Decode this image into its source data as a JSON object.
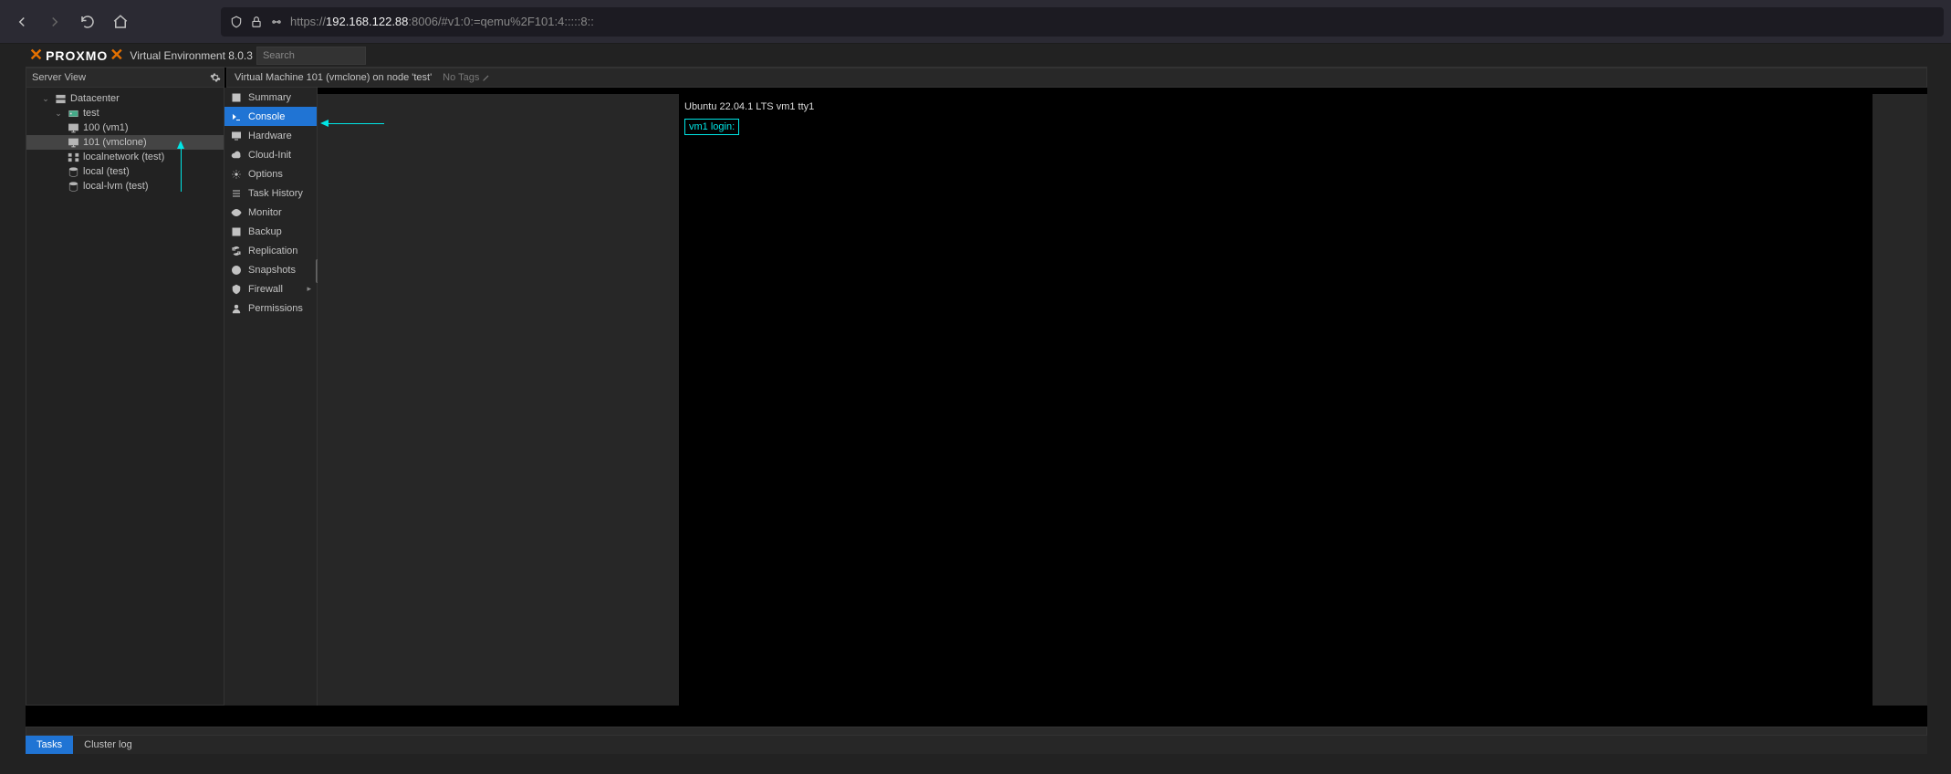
{
  "browser": {
    "url_prefix": "https://",
    "url_host": "192.168.122.88",
    "url_suffix": ":8006/#v1:0:=qemu%2F101:4:::::8::"
  },
  "header": {
    "logo": "PROXMO",
    "ve_label": "Virtual Environment 8.0.3",
    "search_placeholder": "Search"
  },
  "server_view": {
    "label": "Server View"
  },
  "tree": {
    "datacenter": "Datacenter",
    "node": "test",
    "vm1": "100 (vm1)",
    "vm2": "101 (vmclone)",
    "net": "localnetwork (test)",
    "local": "local (test)",
    "lvm": "local-lvm (test)"
  },
  "content": {
    "title": "Virtual Machine 101 (vmclone) on node 'test'",
    "no_tags": "No Tags"
  },
  "tabs": {
    "summary": "Summary",
    "console": "Console",
    "hardware": "Hardware",
    "cloudinit": "Cloud-Init",
    "options": "Options",
    "taskhistory": "Task History",
    "monitor": "Monitor",
    "backup": "Backup",
    "replication": "Replication",
    "snapshots": "Snapshots",
    "firewall": "Firewall",
    "permissions": "Permissions"
  },
  "console": {
    "line1": "Ubuntu 22.04.1 LTS vm1 tty1",
    "line2": "vm1 login:"
  },
  "log": {
    "tasks": "Tasks",
    "cluster": "Cluster log"
  }
}
